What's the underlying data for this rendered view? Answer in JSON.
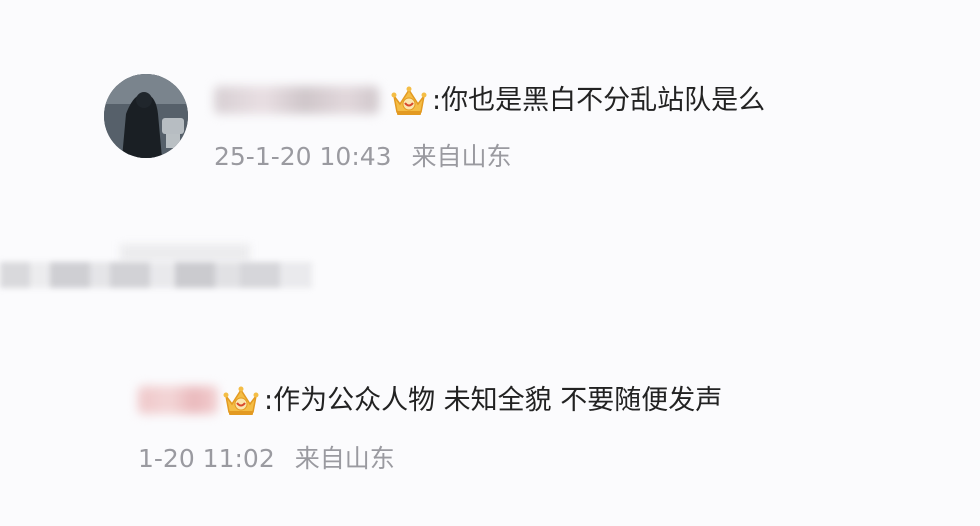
{
  "comments": [
    {
      "text": ":你也是黑白不分乱站队是么",
      "date": "25-1-20 10:43",
      "location": "来自山东"
    },
    {
      "text": ":作为公众人物 未知全貌 不要随便发声",
      "date": "1-20 11:02",
      "location": "来自山东"
    }
  ],
  "colors": {
    "text": "#222222",
    "meta": "#9a9aa0",
    "badge_gold": "#f0b53a",
    "badge_red": "#d9472b"
  },
  "icons": {
    "badge": "crown-badge-icon"
  }
}
